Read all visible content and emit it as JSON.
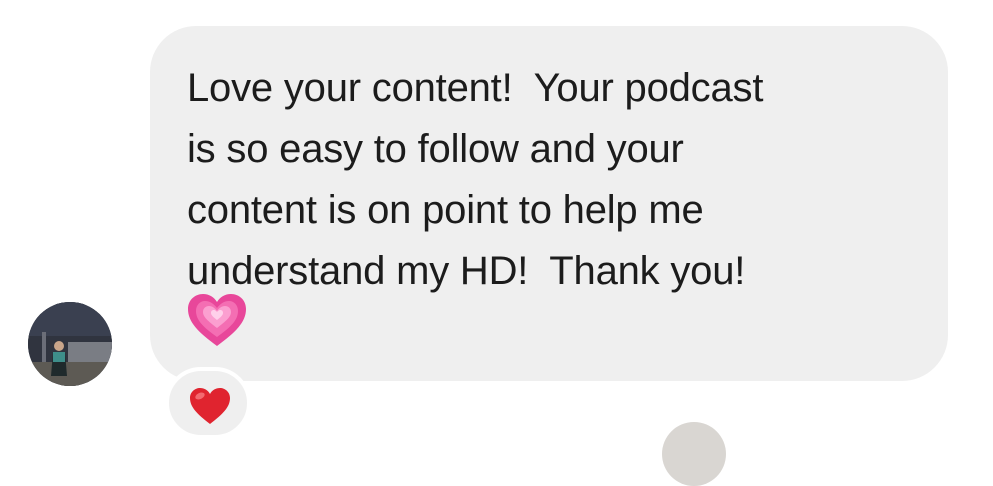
{
  "message": {
    "text_lines": [
      "Love your content!  Your podcast",
      "is so easy to follow and your",
      "content is on point to help me",
      "understand my HD!  Thank you!"
    ],
    "inline_emoji": "growing-heart-icon",
    "reaction": "red-heart-icon"
  },
  "colors": {
    "bubble": "#efefef",
    "text": "#1c1c1c",
    "pink_heart": "#e8479a",
    "red_heart": "#e0242f"
  }
}
